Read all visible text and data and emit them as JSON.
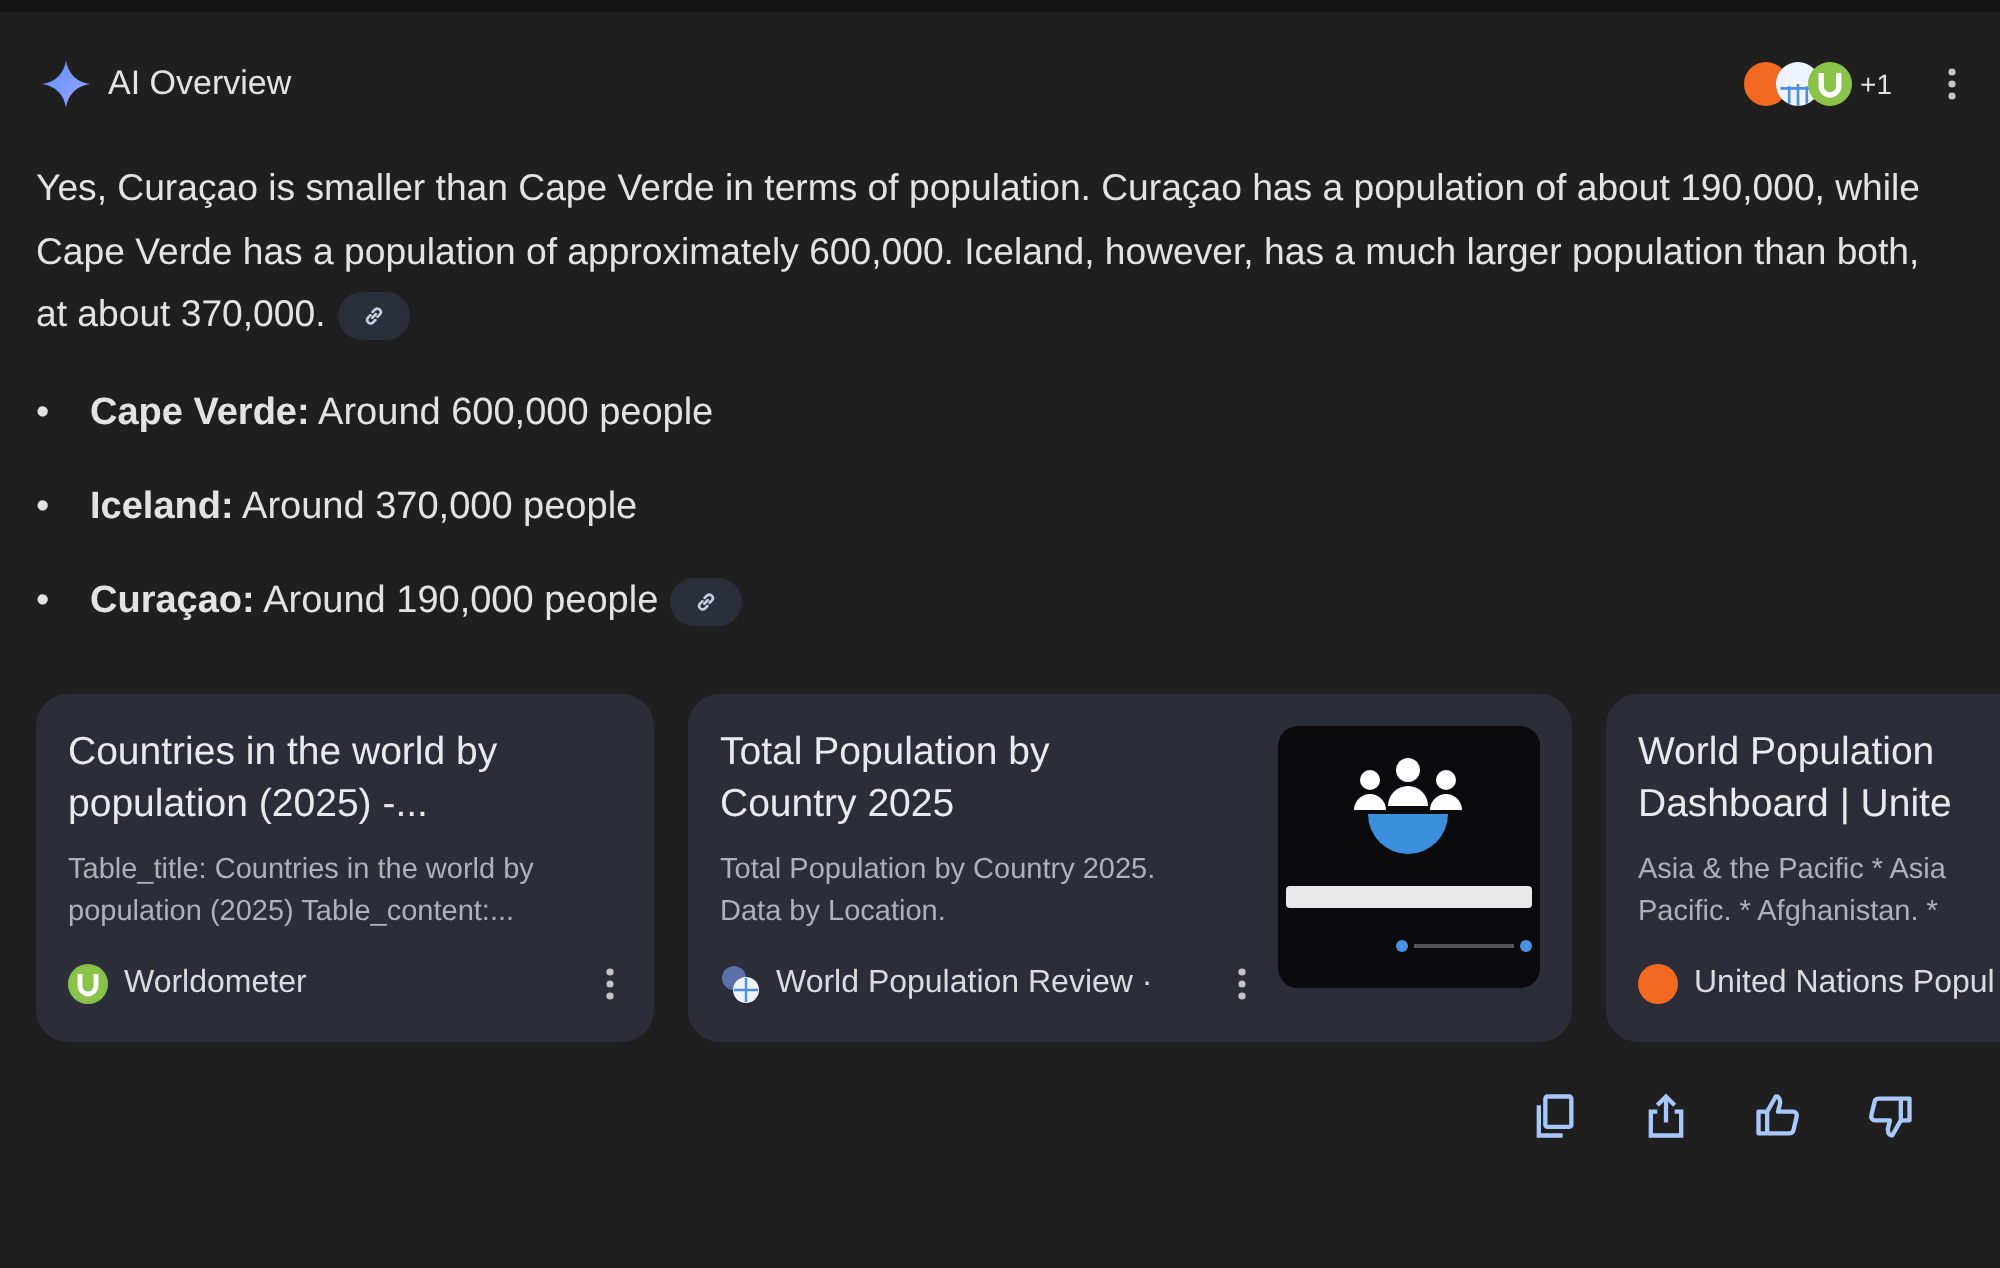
{
  "header": {
    "title": "AI Overview",
    "source_more": "+1"
  },
  "summary": "Yes, Curaçao is smaller than Cape Verde in terms of population. Curaçao has a population of about 190,000, while Cape Verde has a population of approximately 600,000. Iceland, however, has a much larger population than both, at about 370,000.",
  "summary_link": true,
  "bullets": [
    {
      "marker": "•",
      "text": "**Cape Verde:** Around 600,000 people",
      "link": false
    },
    {
      "marker": "•",
      "text": "**Iceland:** Around 370,000 people",
      "link": false
    },
    {
      "marker": "•",
      "text": "**Curaçao:** Around 190,000 people",
      "link": true
    }
  ],
  "cards": [
    {
      "title": "Countries in the world by\npopulation (2025) -...",
      "snippet": "Table_title: Countries in the world by\npopulation (2025) Table_content:...",
      "source": "Worldometer",
      "thumbnail": false,
      "more": true
    },
    {
      "title": "Total Population by\nCountry 2025",
      "snippet": "Total Population by Country 2025.\nData by Location.",
      "source": "World Population Review ·",
      "thumbnail": true,
      "more": true
    },
    {
      "title": "World Population\nDashboard | Unite",
      "snippet": "Asia & the Pacific * Asia\nPacific. * Afghanistan. *",
      "source": "United Nations Popul",
      "thumbnail": false,
      "more": false
    }
  ]
}
